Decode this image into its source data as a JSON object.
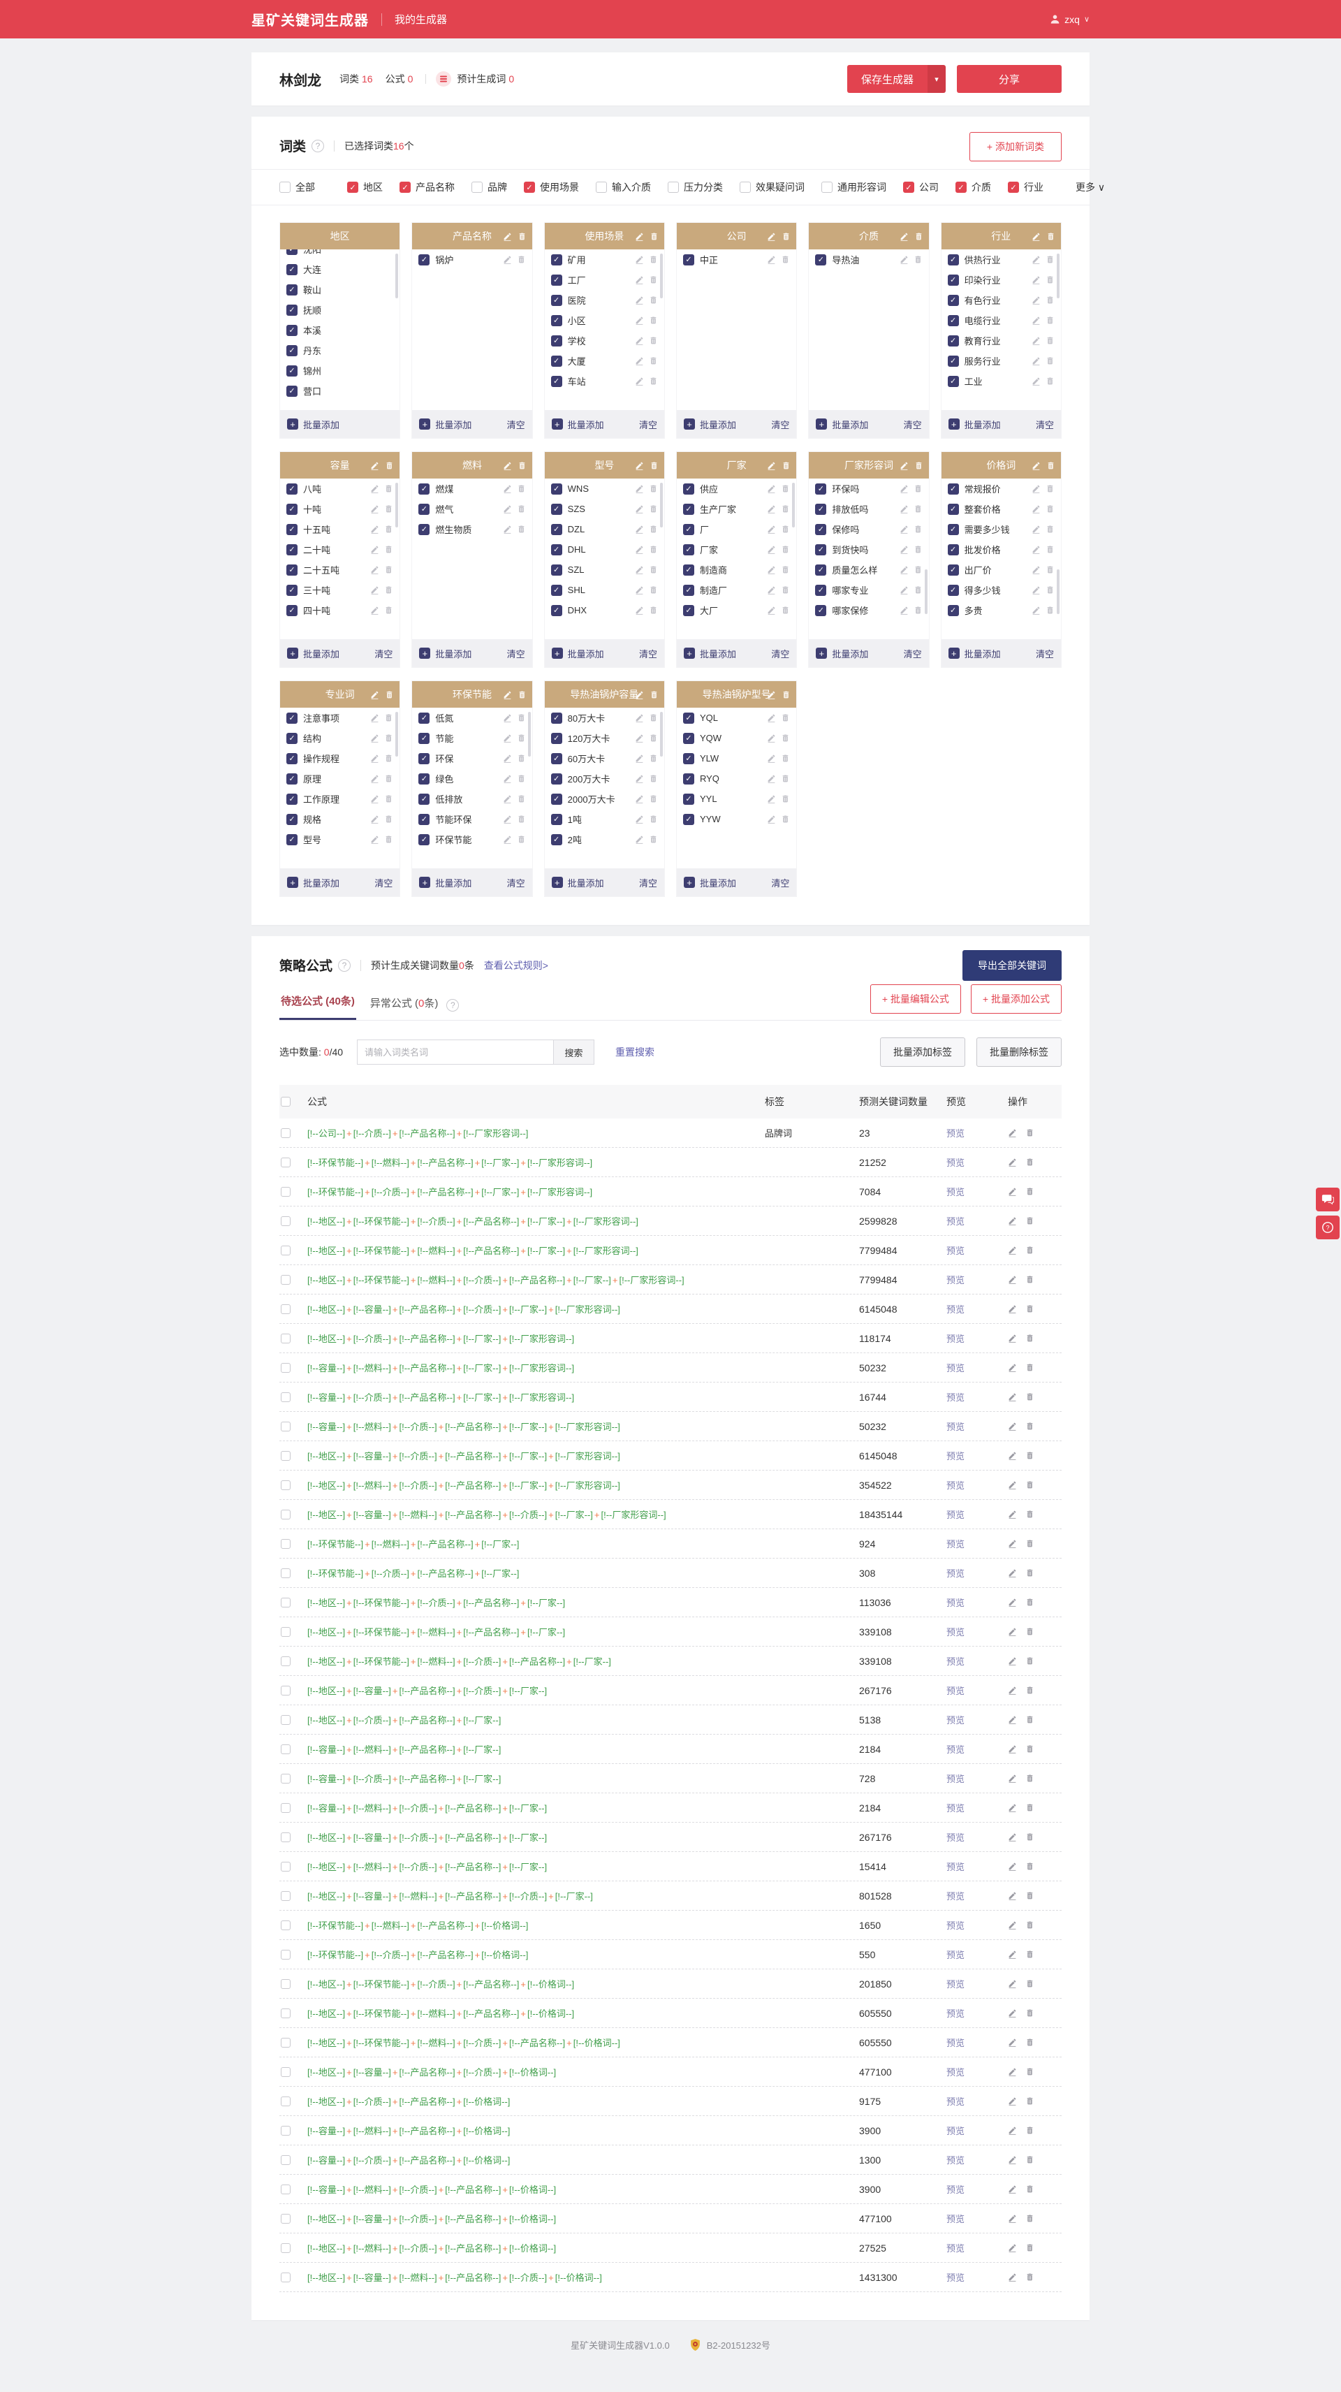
{
  "header": {
    "app_title": "星矿关键词生成器",
    "nav_item": "我的生成器",
    "user_name": "zxq"
  },
  "generator_bar": {
    "name": "林剑龙",
    "wordclass_label": "词类",
    "wordclass_value": "16",
    "formula_label": "公式",
    "formula_value": "0",
    "estimate_label": "预计生成词",
    "estimate_value": "0",
    "save_label": "保存生成器",
    "share_label": "分享"
  },
  "wordclass_section": {
    "title": "词类",
    "selected_prefix": "已选择词类",
    "selected_count": "16",
    "selected_suffix": "个",
    "add_button": "+ 添加新词类",
    "more_label": "更多",
    "batch_add_label": "批量添加",
    "clear_label": "清空",
    "filters": [
      {
        "label": "全部",
        "checked": false
      },
      {
        "label": "地区",
        "checked": true
      },
      {
        "label": "产品名称",
        "checked": true
      },
      {
        "label": "品牌",
        "checked": false
      },
      {
        "label": "使用场景",
        "checked": true
      },
      {
        "label": "输入介质",
        "checked": false
      },
      {
        "label": "压力分类",
        "checked": false
      },
      {
        "label": "效果疑问词",
        "checked": false
      },
      {
        "label": "通用形容词",
        "checked": false
      },
      {
        "label": "公司",
        "checked": true
      },
      {
        "label": "介质",
        "checked": true
      },
      {
        "label": "行业",
        "checked": true
      }
    ],
    "cards": [
      {
        "title": "地区",
        "editable": false,
        "item_icons": false,
        "clear": false,
        "clip_top": true,
        "scrollbar": "top",
        "items": [
          "沈阳",
          "大连",
          "鞍山",
          "抚顺",
          "本溪",
          "丹东",
          "锦州",
          "营口"
        ]
      },
      {
        "title": "产品名称",
        "editable": true,
        "item_icons": true,
        "clear": true,
        "items": [
          "锅炉"
        ]
      },
      {
        "title": "使用场景",
        "editable": true,
        "item_icons": true,
        "clear": true,
        "scrollbar": "top",
        "items": [
          "矿用",
          "工厂",
          "医院",
          "小区",
          "学校",
          "大厦",
          "车站"
        ]
      },
      {
        "title": "公司",
        "editable": true,
        "item_icons": true,
        "clear": true,
        "items": [
          "中正"
        ]
      },
      {
        "title": "介质",
        "editable": true,
        "item_icons": true,
        "clear": true,
        "items": [
          "导热油"
        ]
      },
      {
        "title": "行业",
        "editable": true,
        "item_icons": true,
        "clear": true,
        "scrollbar": "top",
        "items": [
          "供热行业",
          "印染行业",
          "有色行业",
          "电缆行业",
          "教育行业",
          "服务行业",
          "工业"
        ]
      },
      {
        "title": "容量",
        "editable": true,
        "item_icons": true,
        "clear": true,
        "scrollbar": "top",
        "items": [
          "八吨",
          "十吨",
          "十五吨",
          "二十吨",
          "二十五吨",
          "三十吨",
          "四十吨"
        ]
      },
      {
        "title": "燃料",
        "editable": true,
        "item_icons": true,
        "clear": true,
        "items": [
          "燃煤",
          "燃气",
          "燃生物质"
        ]
      },
      {
        "title": "型号",
        "editable": true,
        "item_icons": true,
        "clear": true,
        "scrollbar": "top",
        "items": [
          "WNS",
          "SZS",
          "DZL",
          "DHL",
          "SZL",
          "SHL",
          "DHX"
        ]
      },
      {
        "title": "厂家",
        "editable": true,
        "item_icons": true,
        "clear": true,
        "scrollbar": "top",
        "items": [
          "供应",
          "生产厂家",
          "厂",
          "厂家",
          "制造商",
          "制造厂",
          "大厂"
        ]
      },
      {
        "title": "厂家形容词",
        "editable": true,
        "item_icons": true,
        "clear": true,
        "scrollbar": "low",
        "items": [
          "环保吗",
          "排放低吗",
          "保修吗",
          "到货快吗",
          "质量怎么样",
          "哪家专业",
          "哪家保修"
        ]
      },
      {
        "title": "价格词",
        "editable": true,
        "item_icons": true,
        "clear": true,
        "scrollbar": "low",
        "items": [
          "常规报价",
          "整套价格",
          "需要多少钱",
          "批发价格",
          "出厂价",
          "得多少钱",
          "多贵"
        ]
      },
      {
        "title": "专业词",
        "editable": true,
        "item_icons": true,
        "clear": true,
        "scrollbar": "top",
        "items": [
          "注意事项",
          "结构",
          "操作规程",
          "原理",
          "工作原理",
          "规格",
          "型号"
        ]
      },
      {
        "title": "环保节能",
        "editable": true,
        "item_icons": true,
        "clear": true,
        "scrollbar": "top",
        "items": [
          "低氮",
          "节能",
          "环保",
          "绿色",
          "低排放",
          "节能环保",
          "环保节能"
        ]
      },
      {
        "title": "导热油锅炉容量",
        "editable": true,
        "item_icons": true,
        "clear": true,
        "scrollbar": "top",
        "items": [
          "80万大卡",
          "120万大卡",
          "60万大卡",
          "200万大卡",
          "2000万大卡",
          "1吨",
          "2吨"
        ]
      },
      {
        "title": "导热油锅炉型号",
        "editable": true,
        "item_icons": true,
        "clear": true,
        "items": [
          "YQL",
          "YQW",
          "YLW",
          "RYQ",
          "YYL",
          "YYW"
        ]
      }
    ]
  },
  "formula_section": {
    "title": "策略公式",
    "estimate_prefix": "预计生成关键词数量",
    "estimate_count": "0",
    "estimate_suffix": "条",
    "rules_link": "查看公式规则>",
    "export_button": "导出全部关键词",
    "tab_active": "待选公式 (40条)",
    "tab2_prefix": "异常公式 (",
    "tab2_count": "0",
    "tab2_suffix": "条)",
    "batch_edit_button": "+ 批量编辑公式",
    "batch_add_button": "+ 批量添加公式",
    "selected_prefix": "选中数量: ",
    "selected_num": "0",
    "selected_total": "/40",
    "search_placeholder": "请输入词类名词",
    "search_button": "搜索",
    "reset_button": "重置搜索",
    "tag_add_button": "批量添加标签",
    "tag_delete_button": "批量删除标签",
    "table": {
      "headers": {
        "formula": "公式",
        "tag": "标签",
        "count": "预测关键词数量",
        "preview": "预览",
        "action": "操作"
      },
      "preview_label": "预览",
      "rows": [
        {
          "parts": [
            "公司",
            "介质",
            "产品名称",
            "厂家形容词"
          ],
          "tag": "品牌词",
          "count": "23"
        },
        {
          "parts": [
            "环保节能",
            "燃料",
            "产品名称",
            "厂家",
            "厂家形容词"
          ],
          "tag": "",
          "count": "21252"
        },
        {
          "parts": [
            "环保节能",
            "介质",
            "产品名称",
            "厂家",
            "厂家形容词"
          ],
          "tag": "",
          "count": "7084"
        },
        {
          "parts": [
            "地区",
            "环保节能",
            "介质",
            "产品名称",
            "厂家",
            "厂家形容词"
          ],
          "tag": "",
          "count": "2599828"
        },
        {
          "parts": [
            "地区",
            "环保节能",
            "燃料",
            "产品名称",
            "厂家",
            "厂家形容词"
          ],
          "tag": "",
          "count": "7799484"
        },
        {
          "parts": [
            "地区",
            "环保节能",
            "燃料",
            "介质",
            "产品名称",
            "厂家",
            "厂家形容词"
          ],
          "tag": "",
          "count": "7799484"
        },
        {
          "parts": [
            "地区",
            "容量",
            "产品名称",
            "介质",
            "厂家",
            "厂家形容词"
          ],
          "tag": "",
          "count": "6145048"
        },
        {
          "parts": [
            "地区",
            "介质",
            "产品名称",
            "厂家",
            "厂家形容词"
          ],
          "tag": "",
          "count": "118174"
        },
        {
          "parts": [
            "容量",
            "燃料",
            "产品名称",
            "厂家",
            "厂家形容词"
          ],
          "tag": "",
          "count": "50232"
        },
        {
          "parts": [
            "容量",
            "介质",
            "产品名称",
            "厂家",
            "厂家形容词"
          ],
          "tag": "",
          "count": "16744"
        },
        {
          "parts": [
            "容量",
            "燃料",
            "介质",
            "产品名称",
            "厂家",
            "厂家形容词"
          ],
          "tag": "",
          "count": "50232"
        },
        {
          "parts": [
            "地区",
            "容量",
            "介质",
            "产品名称",
            "厂家",
            "厂家形容词"
          ],
          "tag": "",
          "count": "6145048"
        },
        {
          "parts": [
            "地区",
            "燃料",
            "介质",
            "产品名称",
            "厂家",
            "厂家形容词"
          ],
          "tag": "",
          "count": "354522"
        },
        {
          "parts": [
            "地区",
            "容量",
            "燃料",
            "产品名称",
            "介质",
            "厂家",
            "厂家形容词"
          ],
          "tag": "",
          "count": "18435144"
        },
        {
          "parts": [
            "环保节能",
            "燃料",
            "产品名称",
            "厂家"
          ],
          "tag": "",
          "count": "924"
        },
        {
          "parts": [
            "环保节能",
            "介质",
            "产品名称",
            "厂家"
          ],
          "tag": "",
          "count": "308"
        },
        {
          "parts": [
            "地区",
            "环保节能",
            "介质",
            "产品名称",
            "厂家"
          ],
          "tag": "",
          "count": "113036"
        },
        {
          "parts": [
            "地区",
            "环保节能",
            "燃料",
            "产品名称",
            "厂家"
          ],
          "tag": "",
          "count": "339108"
        },
        {
          "parts": [
            "地区",
            "环保节能",
            "燃料",
            "介质",
            "产品名称",
            "厂家"
          ],
          "tag": "",
          "count": "339108"
        },
        {
          "parts": [
            "地区",
            "容量",
            "产品名称",
            "介质",
            "厂家"
          ],
          "tag": "",
          "count": "267176"
        },
        {
          "parts": [
            "地区",
            "介质",
            "产品名称",
            "厂家"
          ],
          "tag": "",
          "count": "5138"
        },
        {
          "parts": [
            "容量",
            "燃料",
            "产品名称",
            "厂家"
          ],
          "tag": "",
          "count": "2184"
        },
        {
          "parts": [
            "容量",
            "介质",
            "产品名称",
            "厂家"
          ],
          "tag": "",
          "count": "728"
        },
        {
          "parts": [
            "容量",
            "燃料",
            "介质",
            "产品名称",
            "厂家"
          ],
          "tag": "",
          "count": "2184"
        },
        {
          "parts": [
            "地区",
            "容量",
            "介质",
            "产品名称",
            "厂家"
          ],
          "tag": "",
          "count": "267176"
        },
        {
          "parts": [
            "地区",
            "燃料",
            "介质",
            "产品名称",
            "厂家"
          ],
          "tag": "",
          "count": "15414"
        },
        {
          "parts": [
            "地区",
            "容量",
            "燃料",
            "产品名称",
            "介质",
            "厂家"
          ],
          "tag": "",
          "count": "801528"
        },
        {
          "parts": [
            "环保节能",
            "燃料",
            "产品名称",
            "价格词"
          ],
          "tag": "",
          "count": "1650"
        },
        {
          "parts": [
            "环保节能",
            "介质",
            "产品名称",
            "价格词"
          ],
          "tag": "",
          "count": "550"
        },
        {
          "parts": [
            "地区",
            "环保节能",
            "介质",
            "产品名称",
            "价格词"
          ],
          "tag": "",
          "count": "201850"
        },
        {
          "parts": [
            "地区",
            "环保节能",
            "燃料",
            "产品名称",
            "价格词"
          ],
          "tag": "",
          "count": "605550"
        },
        {
          "parts": [
            "地区",
            "环保节能",
            "燃料",
            "介质",
            "产品名称",
            "价格词"
          ],
          "tag": "",
          "count": "605550"
        },
        {
          "parts": [
            "地区",
            "容量",
            "产品名称",
            "介质",
            "价格词"
          ],
          "tag": "",
          "count": "477100"
        },
        {
          "parts": [
            "地区",
            "介质",
            "产品名称",
            "价格词"
          ],
          "tag": "",
          "count": "9175"
        },
        {
          "parts": [
            "容量",
            "燃料",
            "产品名称",
            "价格词"
          ],
          "tag": "",
          "count": "3900"
        },
        {
          "parts": [
            "容量",
            "介质",
            "产品名称",
            "价格词"
          ],
          "tag": "",
          "count": "1300"
        },
        {
          "parts": [
            "容量",
            "燃料",
            "介质",
            "产品名称",
            "价格词"
          ],
          "tag": "",
          "count": "3900"
        },
        {
          "parts": [
            "地区",
            "容量",
            "介质",
            "产品名称",
            "价格词"
          ],
          "tag": "",
          "count": "477100"
        },
        {
          "parts": [
            "地区",
            "燃料",
            "介质",
            "产品名称",
            "价格词"
          ],
          "tag": "",
          "count": "27525"
        },
        {
          "parts": [
            "地区",
            "容量",
            "燃料",
            "产品名称",
            "介质",
            "价格词"
          ],
          "tag": "",
          "count": "1431300"
        }
      ]
    }
  },
  "footer": {
    "version": "星矿关键词生成器V1.0.0",
    "icp": "B2-20151232号",
    "badge": "police-badge-icon"
  },
  "floating": {
    "chat": "chat-icon",
    "help": "question-icon"
  },
  "colors": {
    "brand_red": "#e2434f",
    "navy": "#3d3d70",
    "tan_header": "#c9a97d",
    "formula_green": "#3f9e4a",
    "plus_orange": "#f07a4a",
    "export_navy": "#2f3b76"
  }
}
